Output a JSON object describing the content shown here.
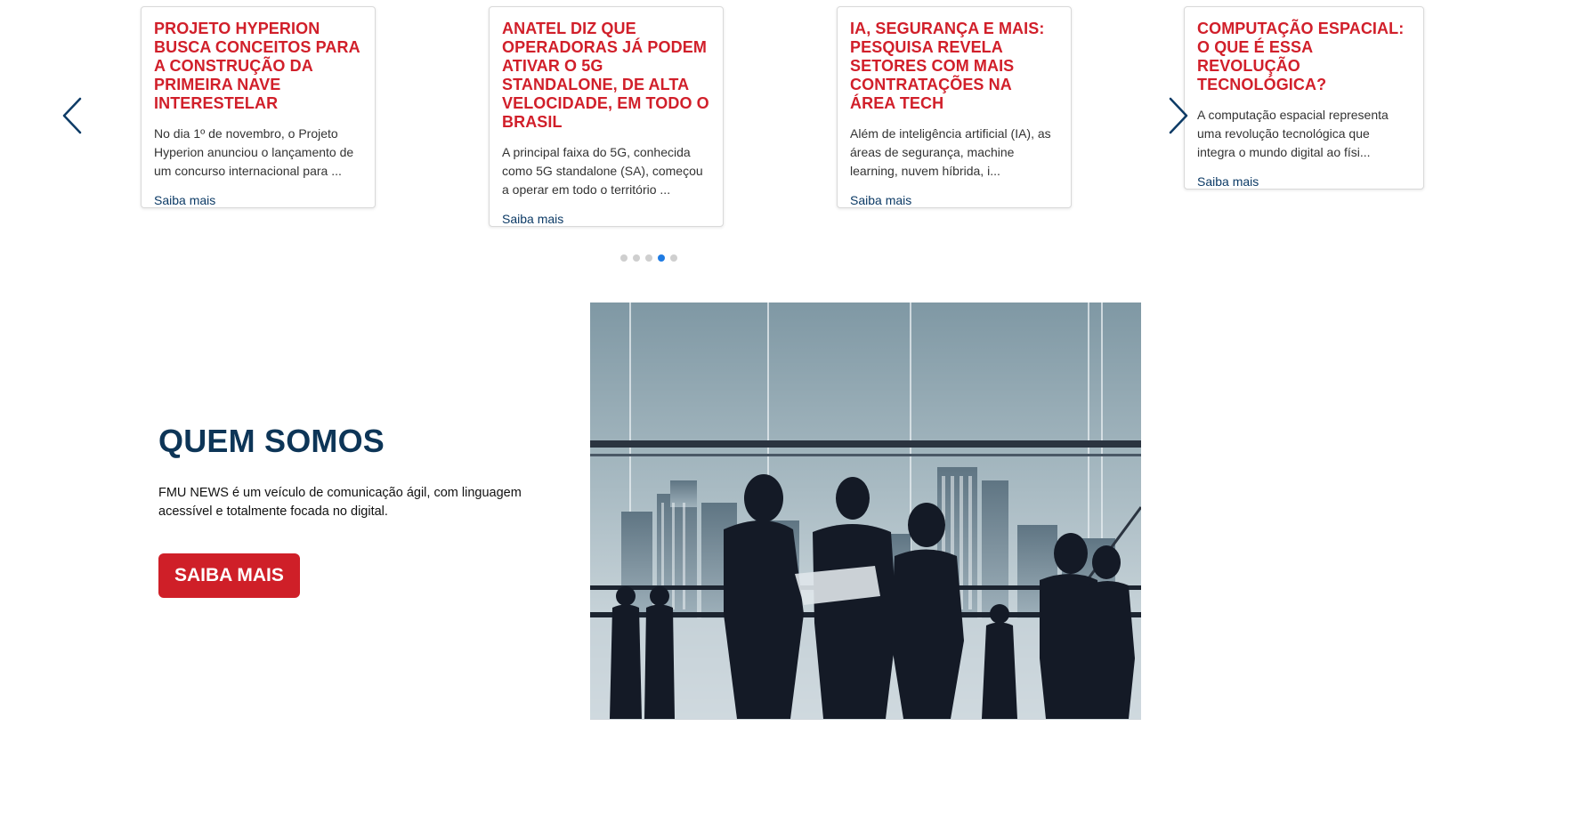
{
  "carousel": {
    "cards": [
      {
        "title": "PROJETO HYPERION BUSCA CONCEITOS PARA A CONSTRUÇÃO DA PRIMEIRA NAVE INTERESTELAR",
        "excerpt": "No dia 1º de novembro, o Projeto Hyperion anunciou o lançamento de um concurso internacional para ...",
        "link": "Saiba mais"
      },
      {
        "title": "ANATEL DIZ QUE OPERADORAS JÁ PODEM ATIVAR O 5G STANDALONE, DE ALTA VELOCIDADE, EM TODO O BRASIL",
        "excerpt": "A principal faixa do 5G, conhecida como 5G standalone (SA), começou a operar em todo o território ...",
        "link": "Saiba mais"
      },
      {
        "title": "IA, SEGURANÇA E MAIS: PESQUISA REVELA SETORES COM MAIS CONTRATAÇÕES NA ÁREA TECH",
        "excerpt": "Além de inteligência artificial (IA), as áreas de segurança, machine learning, nuvem híbrida, i...",
        "link": "Saiba mais"
      },
      {
        "title": "COMPUTAÇÃO ESPACIAL: O QUE É ESSA REVOLUÇÃO TECNOLÓGICA?",
        "excerpt": "A computação espacial representa uma revolução tecnológica que integra o mundo digital ao físi...",
        "link": "Saiba mais"
      }
    ],
    "prev_icon": "chevron-left-icon",
    "next_icon": "chevron-right-icon",
    "pagination": {
      "total": 5,
      "active": 4
    }
  },
  "about": {
    "title": "QUEM SOMOS",
    "text": "FMU NEWS é um veículo de comunicação ágil, com linguagem acessível e totalmente focada no digital.",
    "button_label": "SAIBA MAIS"
  },
  "colors": {
    "headline_red": "#d11f2a",
    "navy": "#0d3557",
    "link_blue": "#0d3b66",
    "button_red": "#cf1f28",
    "dot_active": "#1e7be3",
    "dot_inactive": "#cfcfcf"
  }
}
